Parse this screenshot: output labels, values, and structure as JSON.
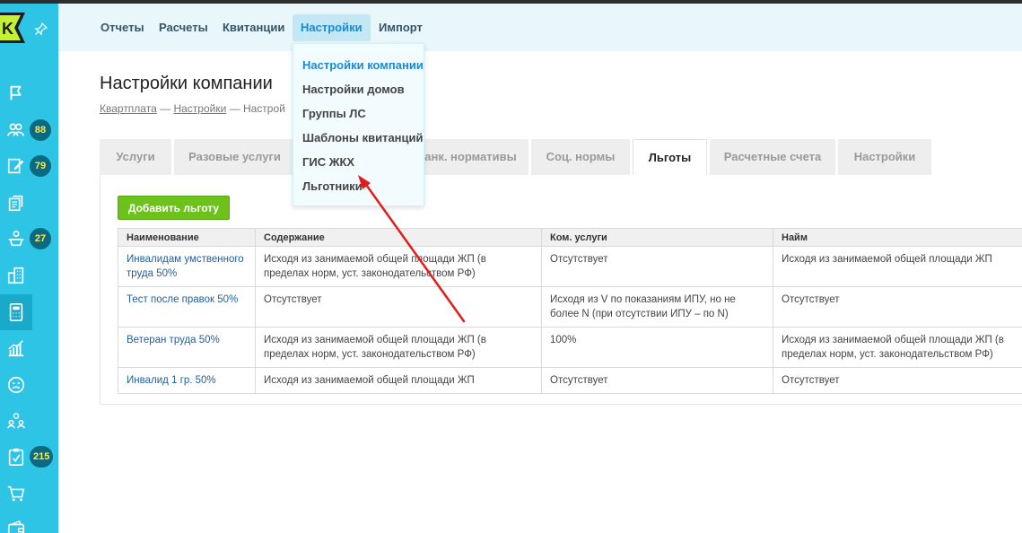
{
  "app": {
    "logo_letter": "K"
  },
  "sidebar": {
    "items": [
      {
        "icon": "flag-icon",
        "badge": ""
      },
      {
        "icon": "people-group-icon",
        "badge": "88"
      },
      {
        "icon": "edit-document-icon",
        "badge": "79"
      },
      {
        "icon": "documents-stack-icon",
        "badge": ""
      },
      {
        "icon": "inspector-icon",
        "badge": "27"
      },
      {
        "icon": "buildings-icon",
        "badge": ""
      },
      {
        "icon": "calculator-icon",
        "badge": "",
        "active": true
      },
      {
        "icon": "stats-chart-icon",
        "badge": ""
      },
      {
        "icon": "sad-face-icon",
        "badge": ""
      },
      {
        "icon": "team-icon",
        "badge": ""
      },
      {
        "icon": "checklist-icon",
        "badge": "215"
      },
      {
        "icon": "cart-icon",
        "badge": ""
      },
      {
        "icon": "wallet-icon",
        "badge": ""
      }
    ]
  },
  "topnav": {
    "items": [
      {
        "label": "Отчеты"
      },
      {
        "label": "Расчеты"
      },
      {
        "label": "Квитанции"
      },
      {
        "label": "Настройки",
        "active": true
      },
      {
        "label": "Импорт"
      }
    ]
  },
  "dropdown": {
    "items": [
      {
        "label": "Настройки компании",
        "active": true
      },
      {
        "label": "Настройки домов"
      },
      {
        "label": "Группы ЛС"
      },
      {
        "label": "Шаблоны квитанций"
      },
      {
        "label": "ГИС ЖКХ"
      },
      {
        "label": "Льготники"
      }
    ]
  },
  "page": {
    "title": "Настройки компании",
    "breadcrumb": [
      "Квартплата",
      "Настройки",
      "Настрой"
    ],
    "breadcrumb_sep": " — "
  },
  "tabs": [
    {
      "label": "Услуги"
    },
    {
      "label": "Разовые услуги"
    },
    {
      "label": "анк. нормативы"
    },
    {
      "label": "Соц. нормы"
    },
    {
      "label": "Льготы",
      "active": true
    },
    {
      "label": "Расчетные счета"
    },
    {
      "label": "Настройки"
    }
  ],
  "add_button": "Добавить льготу",
  "table": {
    "headers": [
      "Наименование",
      "Содержание",
      "Ком. услуги",
      "Найм"
    ],
    "rows": [
      [
        "Инвалидам умственного труда 50%",
        "Исходя из занимаемой общей площади ЖП (в пределах норм, уст. законодательством РФ)",
        "Отсутствует",
        "Исходя из занимаемой общей площади ЖП"
      ],
      [
        "Тест после правок 50%",
        "Отсутствует",
        "Исходя из V по показаниям ИПУ, но не более N (при отсутствии ИПУ – по N)",
        "Отсутствует"
      ],
      [
        "Ветеран труда 50%",
        "Исходя из занимаемой общей площади ЖП (в пределах норм, уст. законодательством РФ)",
        "100%",
        "Исходя из занимаемой общей площади ЖП (в пределах норм, уст. законодательством РФ)"
      ],
      [
        "Инвалид 1 гр. 50%",
        "Исходя из занимаемой общей площади ЖП",
        "Отсутствует",
        "Отсутствует"
      ]
    ]
  },
  "colors": {
    "sidebar": "#2ec4e6",
    "accent": "#1a8ad4",
    "button": "#6cc21a",
    "arrow": "#e21d1d",
    "badge_bg": "#0b6a80",
    "badge_text": "#ffe94a"
  }
}
